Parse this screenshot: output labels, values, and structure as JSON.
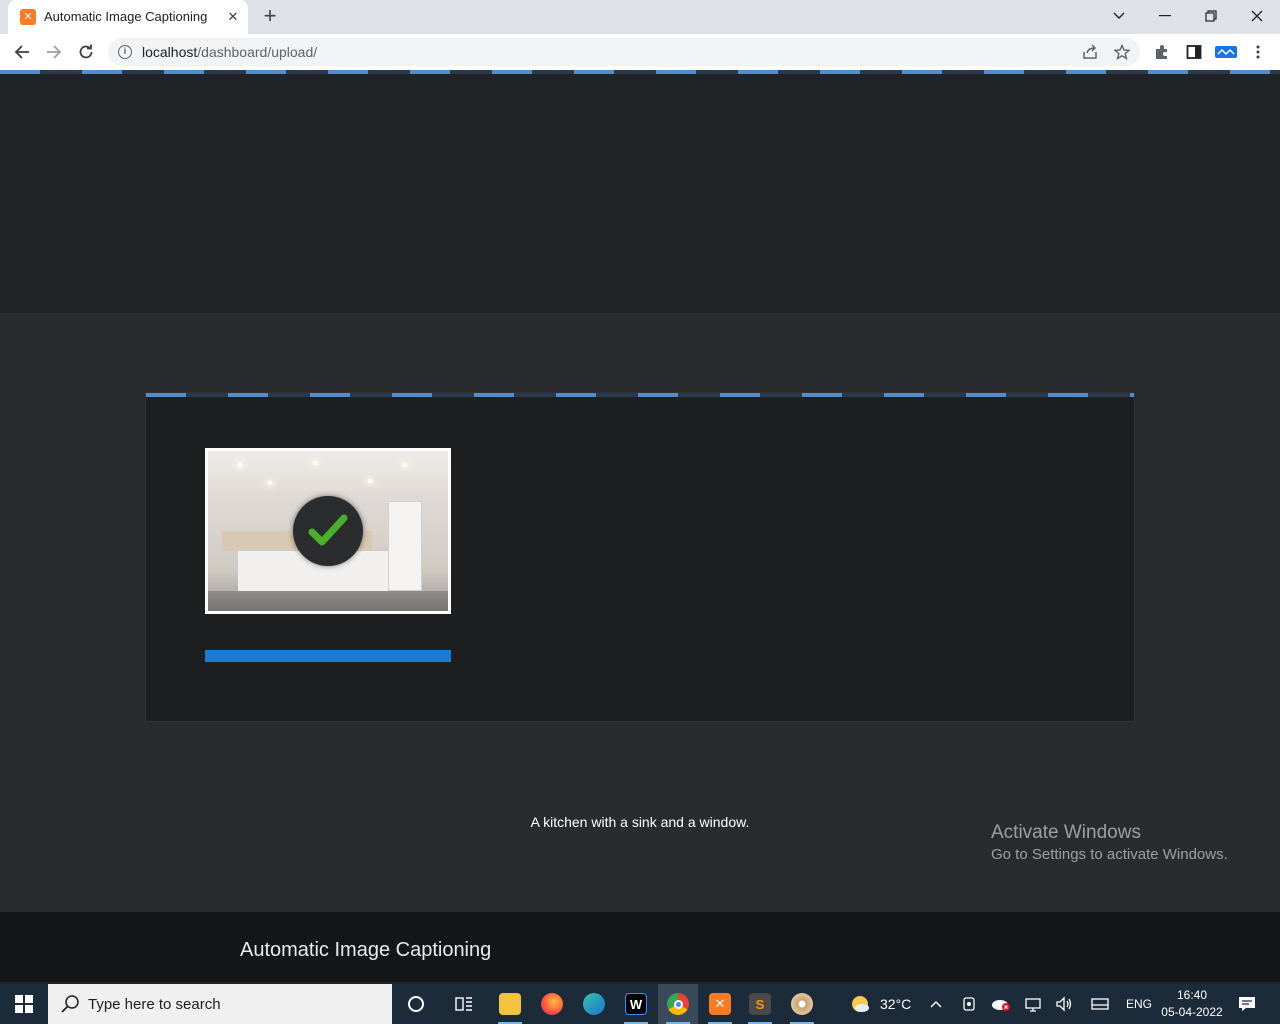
{
  "browser": {
    "tab_title": "Automatic Image Captioning",
    "tab_favicon": "xampp-favicon",
    "url_host": "localhost",
    "url_path": "/dashboard/upload/"
  },
  "upload": {
    "image_alt": "Uploaded kitchen image",
    "status_icon": "check-icon",
    "progress": 1.0
  },
  "caption_text": "A kitchen with a sink and a window.",
  "footer_title": "Automatic Image Captioning",
  "watermark": {
    "line1": "Activate Windows",
    "line2": "Go to Settings to activate Windows."
  },
  "taskbar": {
    "search_placeholder": "Type here to search",
    "weather": "32°C",
    "language": "ENG",
    "time": "16:40",
    "date": "05-04-2022"
  },
  "colors": {
    "accent": "#1e7bd6",
    "stripe_light": "#4f8fcf",
    "check_green": "#4caf2a"
  }
}
